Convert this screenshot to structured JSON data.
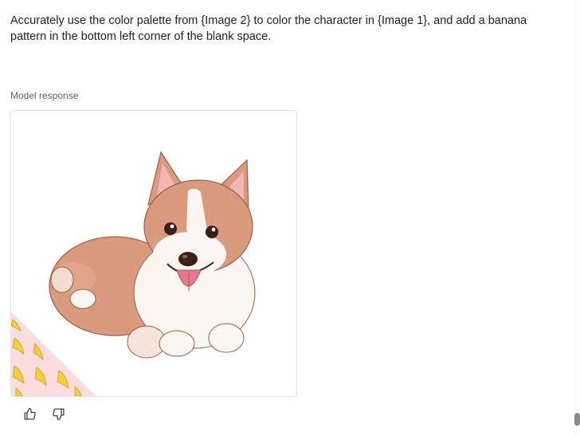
{
  "prompt": {
    "text": "Accurately use the color palette from {Image 2} to color the character in {Image 1}, and add a banana pattern in the bottom left corner of the blank space."
  },
  "response": {
    "label": "Model response",
    "image_subject": "corgi illustration with banana pattern corner"
  },
  "feedback": {
    "thumbs_up_icon": "thumbs-up-icon",
    "thumbs_down_icon": "thumbs-down-icon"
  },
  "colors": {
    "fur": "#d99a7e",
    "fur_dark": "#c07a60",
    "white_fur": "#fbf6f2",
    "ear_inner": "#f0b7b3",
    "tongue": "#e27a8c",
    "banana_bg": "#fbdde0",
    "banana": "#f5cf3b",
    "outline": "#7a4a3a"
  }
}
